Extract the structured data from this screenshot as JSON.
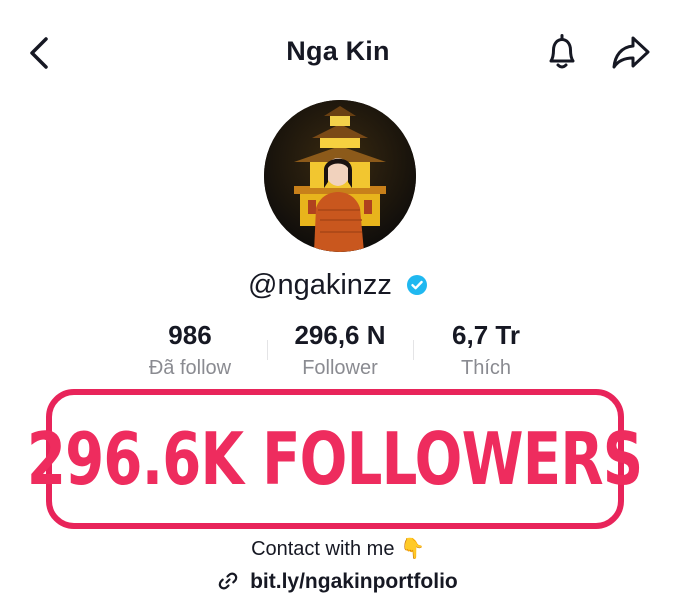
{
  "header": {
    "title": "Nga Kin",
    "back_icon": "chevron-left-icon",
    "bell_icon": "bell-icon",
    "share_icon": "share-arrow-icon"
  },
  "profile": {
    "username": "@ngakinzz",
    "verified": true,
    "verified_color": "#20b8f0"
  },
  "stats": [
    {
      "value": "986",
      "label": "Đã follow"
    },
    {
      "value": "296,6 N",
      "label": "Follower"
    },
    {
      "value": "6,7 Tr",
      "label": "Thích"
    }
  ],
  "banner": {
    "text": "296.6K FOLLOWERS",
    "color": "#ee2c5e"
  },
  "bio": {
    "text": "Contact with me",
    "emoji": "👇"
  },
  "link": {
    "text": "bit.ly/ngakinportfolio",
    "icon": "link-icon"
  }
}
